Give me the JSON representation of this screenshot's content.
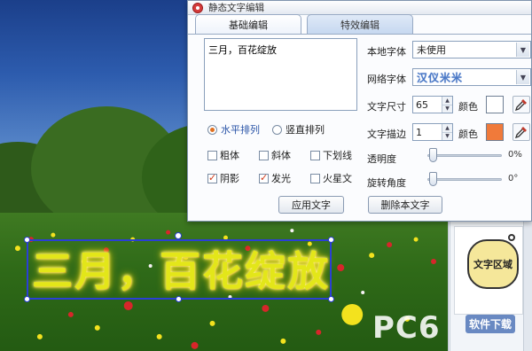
{
  "dialog": {
    "title": "静态文字编辑",
    "tabs": [
      {
        "label": "基础编辑",
        "active": true
      },
      {
        "label": "特效编辑",
        "active": false
      }
    ],
    "text_value": "三月，百花绽放",
    "orientation": {
      "horizontal_label": "水平排列",
      "vertical_label": "竖直排列",
      "selected": "horizontal"
    },
    "styles": [
      {
        "label": "粗体",
        "checked": false
      },
      {
        "label": "斜体",
        "checked": false
      },
      {
        "label": "下划线",
        "checked": false
      },
      {
        "label": "阴影",
        "checked": true
      },
      {
        "label": "发光",
        "checked": true
      },
      {
        "label": "火星文",
        "checked": false
      }
    ],
    "apply_button": "应用文字",
    "delete_button": "删除本文字",
    "local_font": {
      "label": "本地字体",
      "value": "未使用"
    },
    "web_font": {
      "label": "网络字体",
      "value": "汉仪米米"
    },
    "text_size": {
      "label": "文字尺寸",
      "value": "65",
      "color_label": "颜色",
      "color": "#ffffff"
    },
    "text_stroke": {
      "label": "文字描边",
      "value": "1",
      "color_label": "颜色",
      "color": "#f07a3a"
    },
    "opacity": {
      "label": "透明度",
      "value_text": "0%",
      "fraction": 0.0
    },
    "rotation": {
      "label": "旋转角度",
      "value_text": "0°",
      "fraction": 0.0
    }
  },
  "canvas": {
    "art_text": "三月，百花绽放",
    "text_color": "#e3e619"
  },
  "side_panel": {
    "bubble_label": "文字区域"
  },
  "watermark": {
    "main": "PC6",
    "sub": "软件下载"
  }
}
